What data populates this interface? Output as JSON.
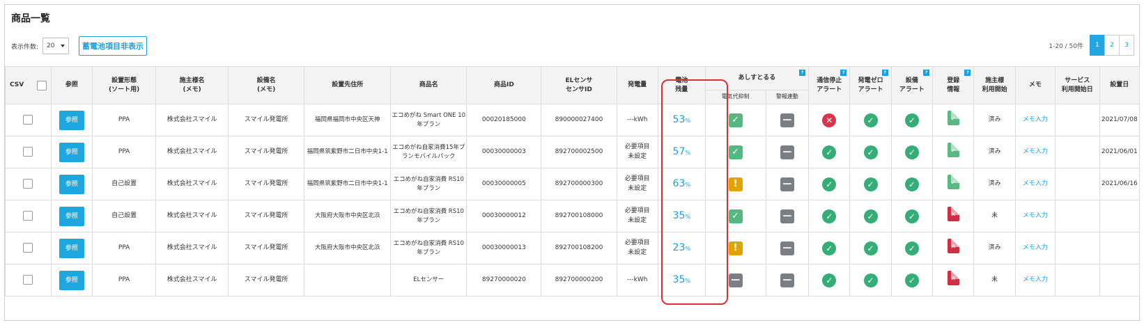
{
  "page": {
    "title": "商品一覧"
  },
  "toolbar": {
    "per_page_label": "表示件数:",
    "per_page_value": "20",
    "toggle_button": "蓄電池項目非表示"
  },
  "pagination": {
    "range": "1-20 / 50件",
    "pages": [
      "1",
      "2",
      "3"
    ],
    "current": "1"
  },
  "table": {
    "headers": {
      "csv": "CSV",
      "ref": "参照",
      "install_type": "設置形態\n(ソート用)",
      "owner": "施主様名\n(メモ)",
      "equipment": "設備名\n(メモ)",
      "address": "設置先住所",
      "product": "商品名",
      "product_id": "商品ID",
      "sensor_id": "ELセンサ\nセンサID",
      "generation": "発電量",
      "battery": "電池\n残量",
      "group": "あしすとるる",
      "sub_power_control": "電気代抑制",
      "sub_alarm_link": "警報連動",
      "comm_stop": "通信停止\nアラート",
      "zero_gen": "発電ゼロ\nアラート",
      "equip_alert": "設備\nアラート",
      "registration": "登録\n情報",
      "owner_start": "施主様\n利用開始",
      "memo": "メモ",
      "service_start": "サービス\n利用開始日",
      "install_date": "設置日"
    },
    "rows": [
      {
        "ref": "参照",
        "install_type": "PPA",
        "owner": "株式会社スマイル",
        "equipment": "スマイル発電所",
        "address": "福岡県福岡市中央区天神",
        "product": "エコめがね Smart ONE 10 年プラン",
        "product_id": "00020185000",
        "sensor_id": "890000027400",
        "generation": "---kWh",
        "battery": "53",
        "power_control": "check",
        "alarm_link": "minus",
        "comm_stop": "error",
        "zero_gen": "ok",
        "equip_alert": "ok",
        "registration": "ok",
        "owner_start": "済み",
        "memo": "メモ入力",
        "service_start": "",
        "install_date": "2021/07/08"
      },
      {
        "ref": "参照",
        "install_type": "PPA",
        "owner": "株式会社スマイル",
        "equipment": "スマイル発電所",
        "address": "福岡県筑紫野市二日市中央1-1",
        "product": "エコめがね自家消費15年プランモバイルパック",
        "product_id": "00030000003",
        "sensor_id": "892700002500",
        "generation": "必要項目\n未設定",
        "battery": "57",
        "power_control": "check",
        "alarm_link": "minus",
        "comm_stop": "ok",
        "zero_gen": "ok",
        "equip_alert": "ok",
        "registration": "ok",
        "owner_start": "済み",
        "memo": "メモ入力",
        "service_start": "",
        "install_date": "2021/06/01"
      },
      {
        "ref": "参照",
        "install_type": "自己設置",
        "owner": "株式会社スマイル",
        "equipment": "スマイル発電所",
        "address": "福岡県筑紫野市二日市中央1-1",
        "product": "エコめがね自家消費 RS10 年プラン",
        "product_id": "00030000005",
        "sensor_id": "892700000300",
        "generation": "必要項目\n未設定",
        "battery": "63",
        "power_control": "warn",
        "alarm_link": "minus",
        "comm_stop": "ok",
        "zero_gen": "ok",
        "equip_alert": "ok",
        "registration": "ok",
        "owner_start": "済み",
        "memo": "メモ入力",
        "service_start": "",
        "install_date": "2021/06/16"
      },
      {
        "ref": "参照",
        "install_type": "自己設置",
        "owner": "株式会社スマイル",
        "equipment": "スマイル発電所",
        "address": "大阪府大阪市中央区北浜",
        "product": "エコめがね自家消費 RS10 年プラン",
        "product_id": "00030000012",
        "sensor_id": "892700108000",
        "generation": "必要項目\n未設定",
        "battery": "35",
        "power_control": "check",
        "alarm_link": "minus",
        "comm_stop": "ok",
        "zero_gen": "ok",
        "equip_alert": "ok",
        "registration": "ng",
        "owner_start": "未",
        "memo": "メモ入力",
        "service_start": "",
        "install_date": ""
      },
      {
        "ref": "参照",
        "install_type": "PPA",
        "owner": "株式会社スマイル",
        "equipment": "スマイル発電所",
        "address": "大阪府大阪市中央区北浜",
        "product": "エコめがね自家消費 RS10 年プラン",
        "product_id": "00030000013",
        "sensor_id": "892700108200",
        "generation": "必要項目\n未設定",
        "battery": "23",
        "power_control": "warn",
        "alarm_link": "minus",
        "comm_stop": "ok",
        "zero_gen": "ok",
        "equip_alert": "ok",
        "registration": "ng",
        "owner_start": "済み",
        "memo": "メモ入力",
        "service_start": "",
        "install_date": ""
      },
      {
        "ref": "参照",
        "install_type": "PPA",
        "owner": "株式会社スマイル",
        "equipment": "スマイル発電所",
        "address": "",
        "product": "ELセンサー",
        "product_id": "89270000020",
        "sensor_id": "892700000200",
        "generation": "---kWh",
        "battery": "35",
        "power_control": "minus",
        "alarm_link": "minus",
        "comm_stop": "ok",
        "zero_gen": "ok",
        "equip_alert": "ok",
        "registration": "ng",
        "owner_start": "未",
        "memo": "メモ入力",
        "service_start": "",
        "install_date": ""
      }
    ],
    "battery_unit": "%",
    "help_badge": "?"
  },
  "colors": {
    "accent": "#1ea6de",
    "ok": "#35ad77",
    "error": "#d8344d",
    "warn": "#e0a300",
    "neutral": "#7a7e85",
    "highlight": "#d93036"
  }
}
